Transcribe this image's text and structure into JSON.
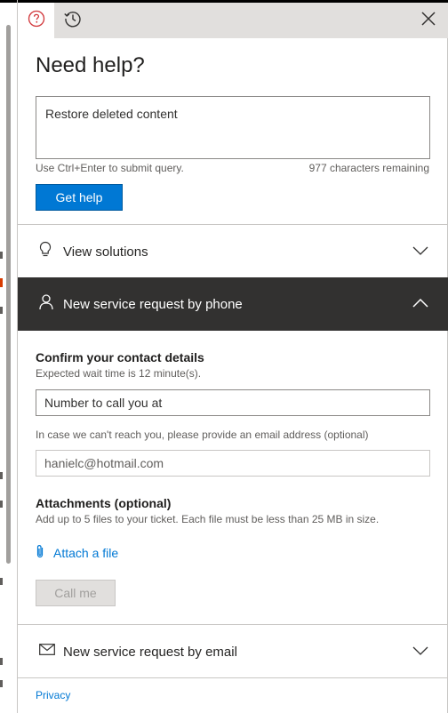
{
  "tabs": {
    "help_icon": "question-circle-icon",
    "history_icon": "history-icon",
    "close_icon": "close-icon"
  },
  "main": {
    "title": "Need help?",
    "query_value": "Restore deleted content",
    "hint": "Use Ctrl+Enter to submit query.",
    "chars_remaining": "977 characters remaining",
    "get_help_label": "Get help"
  },
  "sections": {
    "view_solutions": "View solutions",
    "phone_request": "New service request by phone",
    "email_request": "New service request by email"
  },
  "phone_form": {
    "confirm_title": "Confirm your contact details",
    "wait_time": "Expected wait time is 12 minute(s).",
    "phone_placeholder": "Number to call you at",
    "email_hint": "In case we can't reach you, please provide an email address (optional)",
    "email_value": "hanielc@hotmail.com",
    "attachments_title": "Attachments (optional)",
    "attachments_hint": "Add up to 5 files to your ticket. Each file must be less than 25 MB in size.",
    "attach_label": "Attach a file",
    "call_me_label": "Call me"
  },
  "footer": {
    "privacy": "Privacy"
  },
  "colors": {
    "accent": "#0078d4",
    "dark_header": "#323130",
    "help_icon": "#d13438"
  }
}
